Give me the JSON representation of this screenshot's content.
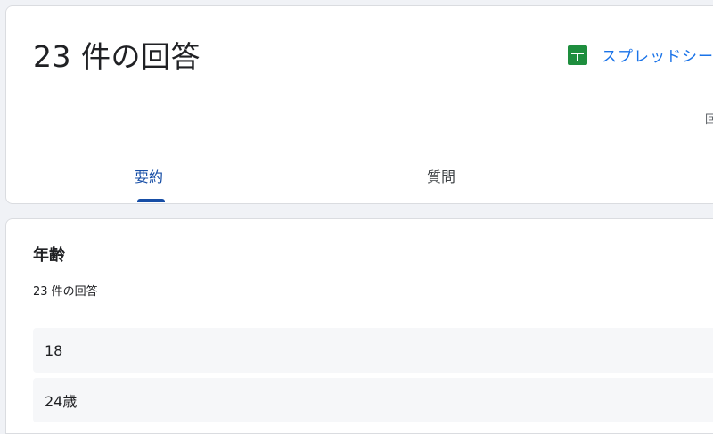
{
  "header": {
    "title": "23 件の回答",
    "sheets_link_label": "スプレッドシー",
    "accept_label_partial": "回",
    "tabs": [
      {
        "label": "要約",
        "active": true
      },
      {
        "label": "質問",
        "active": false
      }
    ]
  },
  "question": {
    "title": "年齢",
    "response_count": "23 件の回答",
    "answers": [
      "18",
      "24歳"
    ]
  },
  "icons": {
    "sheets": "google-sheets-icon"
  },
  "colors": {
    "accent": "#174ea6",
    "link": "#1a73e8",
    "sheets_green": "#1e8e3e"
  }
}
